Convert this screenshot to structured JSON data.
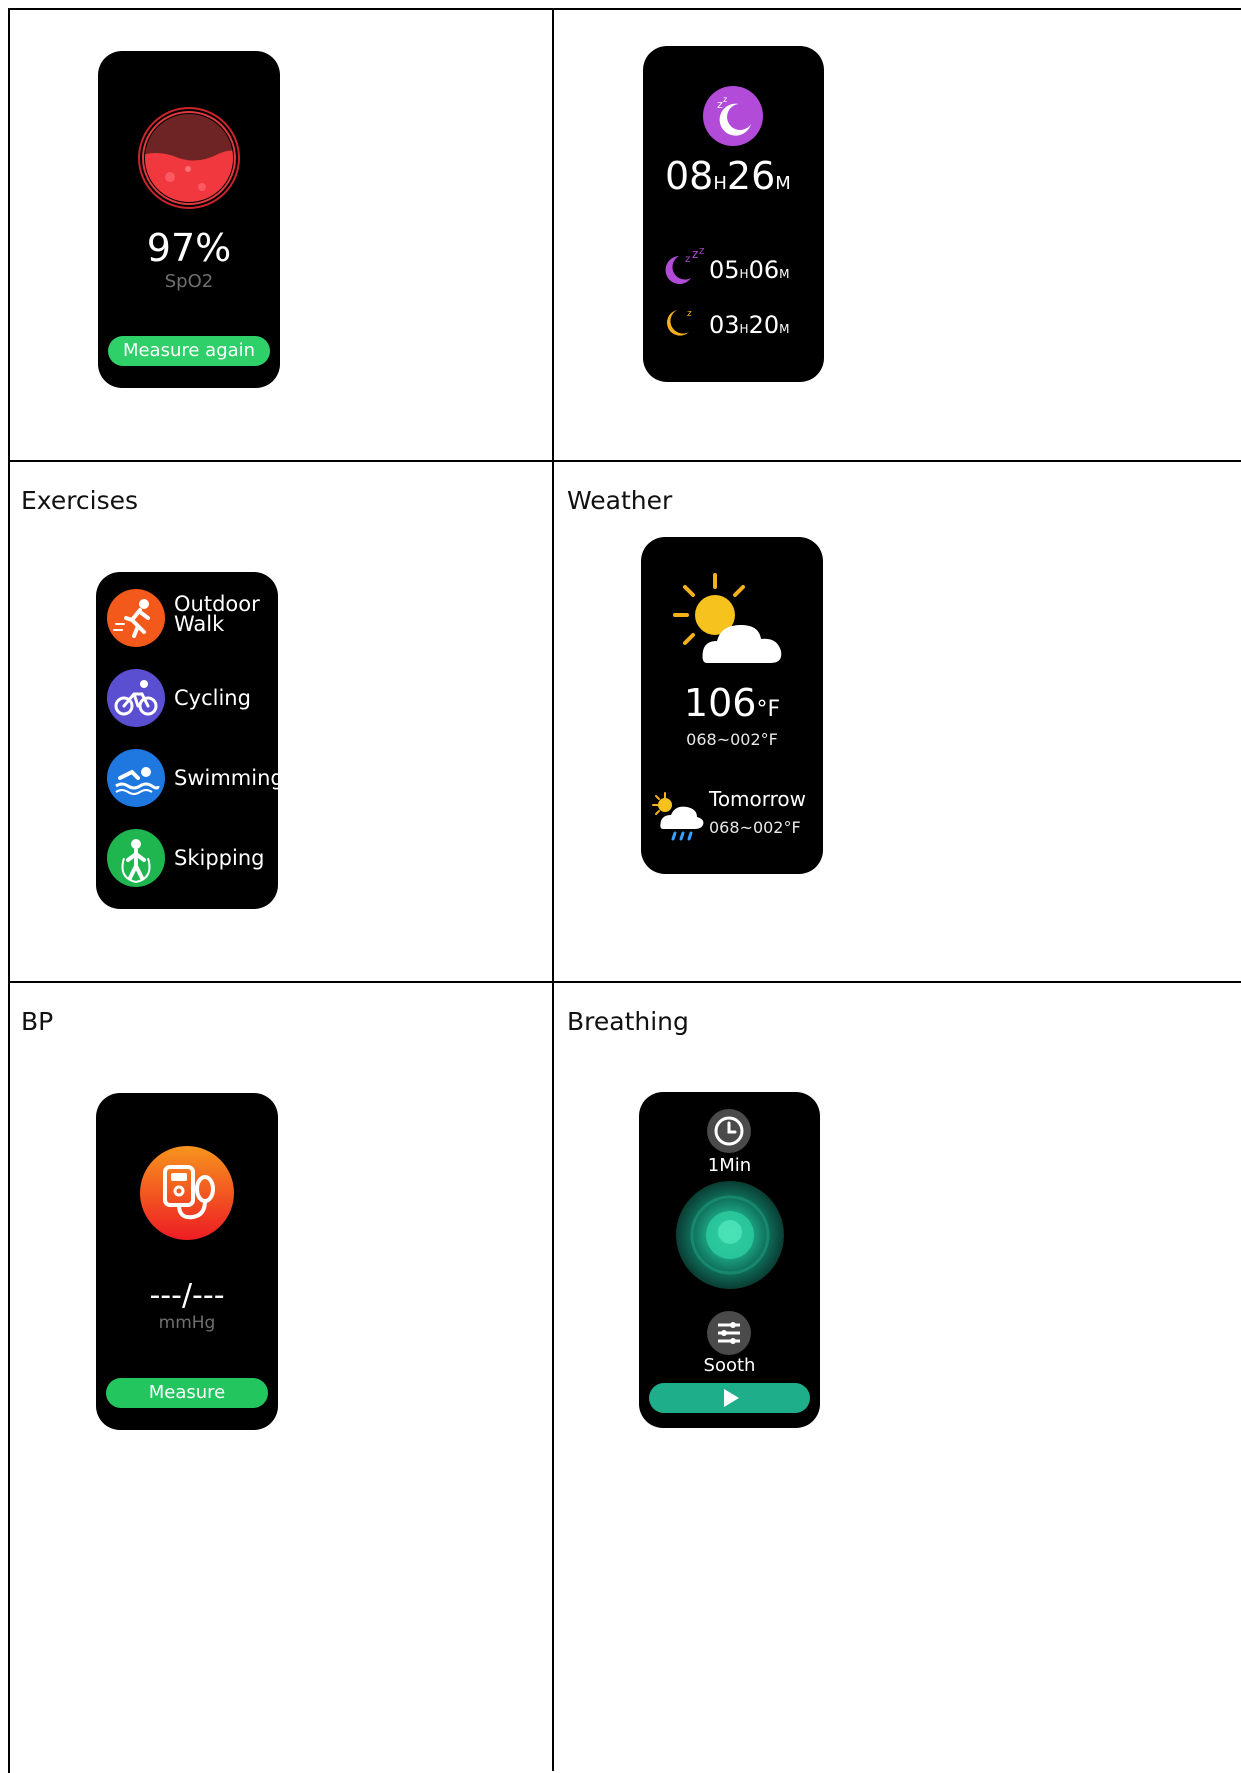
{
  "cells": {
    "exercises": {
      "label": "Exercises"
    },
    "weather": {
      "label": "Weather"
    },
    "bp": {
      "label": "BP"
    },
    "breathing": {
      "label": "Breathing"
    }
  },
  "spo2": {
    "value": "97%",
    "unit": "SpO2",
    "button": "Measure again",
    "accent": "#e8343a",
    "button_color": "#2fcf6a"
  },
  "sleep": {
    "total_h": "08",
    "h_unit": "H",
    "total_m": "26",
    "m_unit": "M",
    "deep_h": "05",
    "deep_m": "06",
    "light_h": "03",
    "light_m": "20",
    "icon_color": "#b14bd8",
    "light_color": "#f5b01e"
  },
  "exercises": {
    "items": [
      {
        "label": "Outdoor\nWalk",
        "label_1": "Outdoor",
        "label_2": "Walk",
        "icon": "walk-icon",
        "color": "#f2591a"
      },
      {
        "label": "Cycling",
        "icon": "cycling-icon",
        "color": "#5a4fd0"
      },
      {
        "label": "Swimming",
        "icon": "swimming-icon",
        "color": "#1f78e0"
      },
      {
        "label": "Skipping",
        "icon": "skipping-icon",
        "color": "#1fb650"
      }
    ]
  },
  "weather": {
    "temp": "106",
    "temp_unit": "°F",
    "range": "068~002°F",
    "tomorrow_label": "Tomorrow",
    "tomorrow_range": "068~002°F"
  },
  "bp": {
    "value": "---/---",
    "unit": "mmHg",
    "button": "Measure",
    "button_color": "#22c55e",
    "icon_color": "#f15a24"
  },
  "breathing": {
    "duration": "1Min",
    "mode": "Sooth",
    "accent": "#1fae8a"
  }
}
